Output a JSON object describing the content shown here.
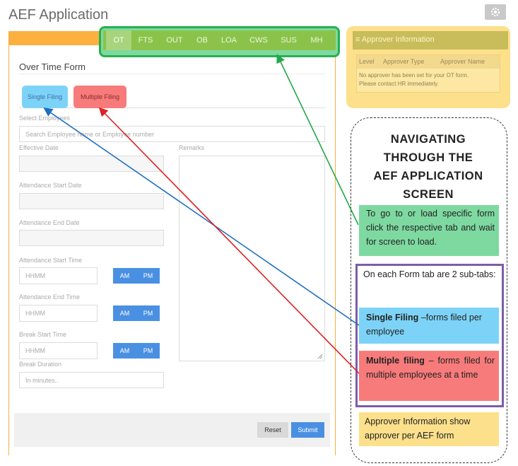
{
  "app": {
    "title": "AEF Application",
    "settings_icon": "gear-icon"
  },
  "tabs": [
    {
      "label": "OT",
      "active": true
    },
    {
      "label": "FTS",
      "active": false
    },
    {
      "label": "OUT",
      "active": false
    },
    {
      "label": "OB",
      "active": false
    },
    {
      "label": "LOA",
      "active": false
    },
    {
      "label": "CWS",
      "active": false
    },
    {
      "label": "SUS",
      "active": false
    },
    {
      "label": "MH",
      "active": false
    }
  ],
  "form": {
    "title": "Over Time Form",
    "subtabs": {
      "single": "Single Filing",
      "multiple": "Multiple Filing"
    },
    "select_employees_label": "Select Employees",
    "search_placeholder": "Search Employee name or Employee number",
    "effective_date_label": "Effective Date",
    "remarks_label": "Remarks",
    "attendance_start_date_label": "Attendance Start Date",
    "attendance_end_date_label": "Attendance End Date",
    "attendance_start_time_label": "Attendance Start Time",
    "attendance_end_time_label": "Attendance End Time",
    "break_start_time_label": "Break Start Time",
    "break_duration_label": "Break Duration",
    "time_placeholder": "HHMM",
    "duration_placeholder": "In minutes..",
    "am": "AM",
    "pm": "PM",
    "reset": "Reset",
    "submit": "Submit"
  },
  "approver": {
    "header": "Approver Information",
    "header_icon": "list-icon",
    "columns": [
      "Level",
      "Approver Type",
      "Approver Name"
    ],
    "message_line1": "No approver has been set for your OT form.",
    "message_line2": "Please contact HR immediately."
  },
  "guide": {
    "title_lines": [
      "NAVIGATING",
      "THROUGH THE",
      "AEF APPLICATION",
      "SCREEN"
    ],
    "tabs_note": "To go to or load specific form click the respective tab and wait for screen to load.",
    "subtabs_intro": "On each Form tab are 2 sub-tabs:",
    "single_keyword": "Single Filing",
    "single_desc": " –forms filed per employee",
    "multiple_keyword": "Multiple filing",
    "multiple_desc": " – forms filed for multiple employees at a time",
    "approver_note": "Approver Information show approver per AEF form"
  },
  "colors": {
    "tabs_highlight": "#27b04f",
    "single_highlight": "#7dd3f7",
    "multiple_highlight": "#f77b7b",
    "approver_highlight": "#fde08b",
    "subtabs_border": "#7b5ea7",
    "form_accent": "#fbb040",
    "button_blue": "#4a90e2",
    "single_arrow": "#1e6fbf",
    "multiple_arrow": "#e02020"
  }
}
